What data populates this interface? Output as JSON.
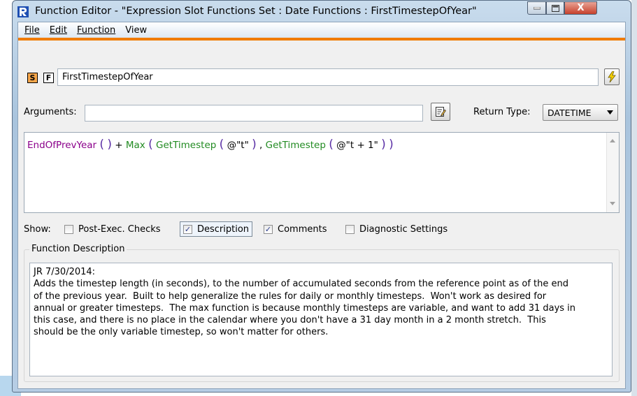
{
  "window": {
    "title": "Function Editor - \"Expression Slot Functions Set : Date Functions : FirstTimestepOfYear\"",
    "close_glyph": "X"
  },
  "menu": {
    "items": [
      "File",
      "Edit",
      "Function",
      "View"
    ]
  },
  "function": {
    "badge_s": "S",
    "badge_f": "F",
    "name": "FirstTimestepOfYear",
    "arguments_label": "Arguments:",
    "arguments_value": "",
    "return_type_label": "Return Type:",
    "return_type_value": "DATETIME"
  },
  "expression": {
    "fn1": "EndOfPrevYear",
    "plus": "+",
    "fn2": "Max",
    "fn3": "GetTimestep",
    "arg1": "@\"t\"",
    "comma": ",",
    "fn4": "GetTimestep",
    "arg2": "@\"t + 1\""
  },
  "show": {
    "label": "Show:",
    "options": [
      {
        "label": "Post-Exec. Checks",
        "checked": false
      },
      {
        "label": "Description",
        "checked": true
      },
      {
        "label": "Comments",
        "checked": true
      },
      {
        "label": "Diagnostic Settings",
        "checked": false
      }
    ]
  },
  "description": {
    "group_title": "Function Description",
    "text": "JR 7/30/2014:\nAdds the timestep length (in seconds), to the number of accumulated seconds from the reference point as of the end\nof the previous year.  Built to help generalize the rules for daily or monthly timesteps.  Won't work as desired for\nannual or greater timesteps.  The max function is because monthly timesteps are variable, and want to add 31 days in\nthis case, and there is no place in the calendar where you don't have a 31 day month in a 2 month stretch.  This\nshould be the only variable timestep, so won't matter for others."
  },
  "icons": {
    "app": "riverware-logo-icon",
    "minimize": "minimize-icon",
    "maximize": "maximize-icon",
    "close": "close-icon",
    "bolt": "lightning-icon",
    "edit": "edit-args-icon",
    "dropdown": "chevron-down-icon"
  },
  "colors": {
    "menu_accent": "#f07c00",
    "badge_s": "#f7a64a",
    "expr_function": "#8b008b",
    "expr_builtin": "#228b22",
    "expr_paren": "#5a2fa5",
    "close_button": "#c7412c"
  }
}
